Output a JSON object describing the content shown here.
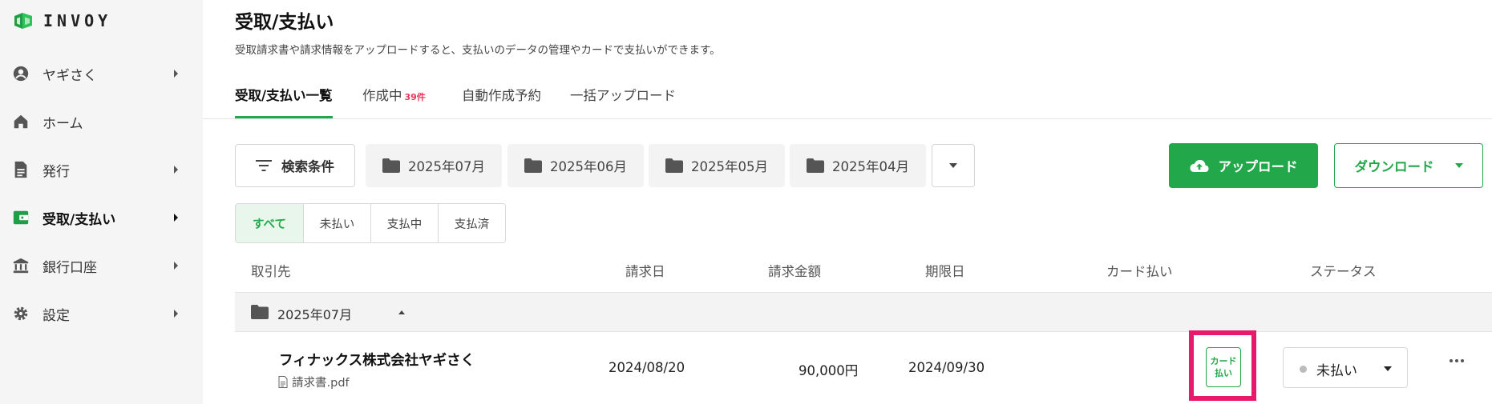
{
  "brand": {
    "name": "INVOY",
    "color": "#22a84a"
  },
  "sidebar": {
    "items": [
      {
        "label": "ヤギさく",
        "icon": "account-circle-icon",
        "has_arrow": true
      },
      {
        "label": "ホーム",
        "icon": "home-icon",
        "has_arrow": false
      },
      {
        "label": "発行",
        "icon": "document-icon",
        "has_arrow": true
      },
      {
        "label": "受取/支払い",
        "icon": "wallet-icon",
        "has_arrow": true,
        "active": true
      },
      {
        "label": "銀行口座",
        "icon": "bank-icon",
        "has_arrow": true
      },
      {
        "label": "設定",
        "icon": "gear-icon",
        "has_arrow": true
      }
    ]
  },
  "header": {
    "title": "受取/支払い",
    "description": "受取請求書や請求情報をアップロードすると、支払いのデータの管理やカードで支払いができます。"
  },
  "tabs": [
    {
      "label": "受取/支払い一覧",
      "active": true
    },
    {
      "label": "作成中",
      "badge": "39件"
    },
    {
      "label": "自動作成予約"
    },
    {
      "label": "一括アップロード"
    }
  ],
  "toolbar": {
    "filter_label": "検索条件",
    "months": [
      "2025年07月",
      "2025年06月",
      "2025年05月",
      "2025年04月"
    ],
    "upload_label": "アップロード",
    "download_label": "ダウンロード"
  },
  "status_filter": {
    "options": [
      "すべて",
      "未払い",
      "支払中",
      "支払済"
    ],
    "selected": "すべて"
  },
  "table": {
    "headers": [
      "取引先",
      "請求日",
      "請求金額",
      "期限日",
      "カード払い",
      "ステータス"
    ],
    "group": {
      "label": "2025年07月"
    },
    "rows": [
      {
        "vendor": "フィナックス株式会社ヤギさく",
        "file": "請求書.pdf",
        "invoice_date": "2024/08/20",
        "amount": "90,000円",
        "due_date": "2024/09/30",
        "card_pay_line1": "カード",
        "card_pay_line2": "払い",
        "status": "未払い"
      }
    ]
  },
  "colors": {
    "accent": "#22a84a",
    "highlight": "#e8196b",
    "badge": "#e53a5a"
  }
}
